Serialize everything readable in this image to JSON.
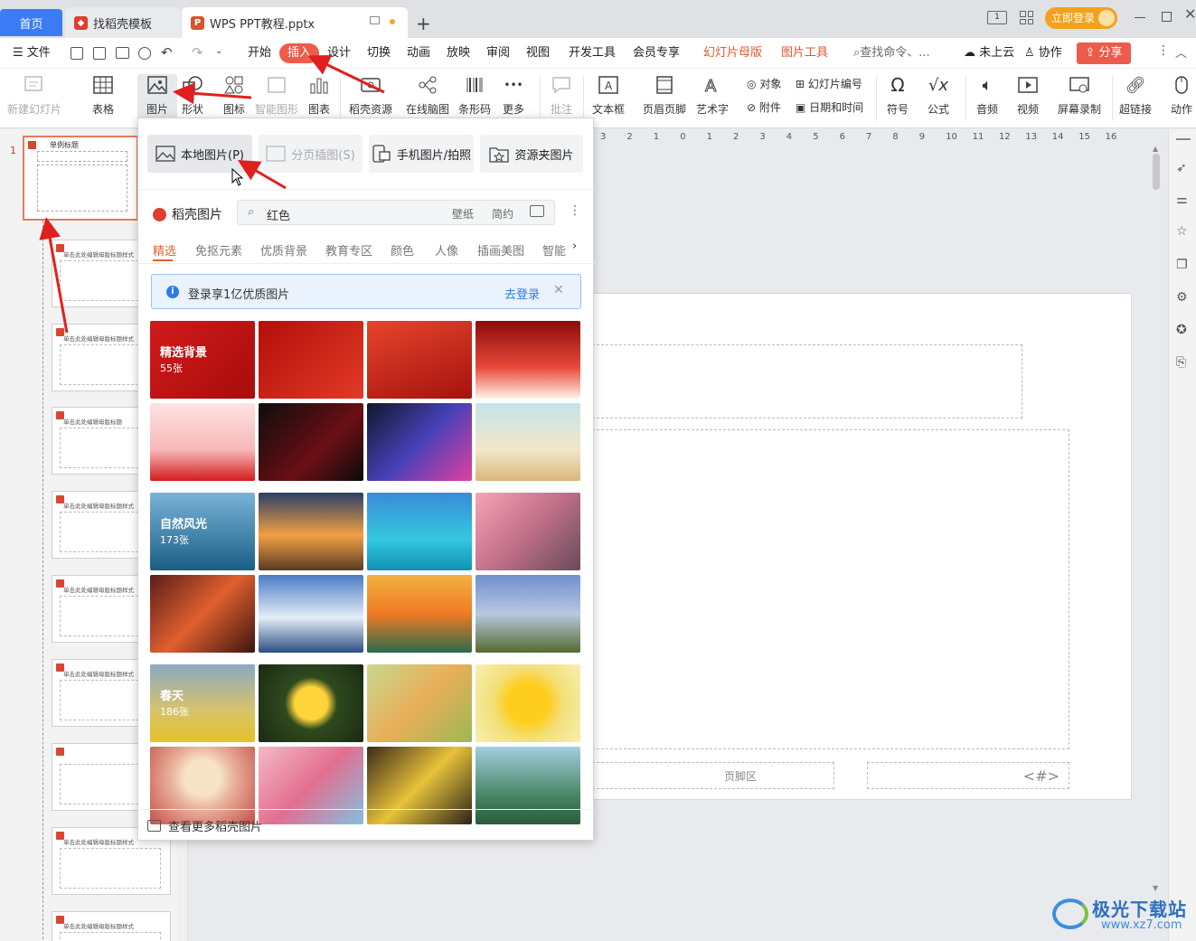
{
  "tabs": {
    "home": "首页",
    "template": "找稻壳模板",
    "document": "WPS PPT教程.pptx",
    "login": "立即登录"
  },
  "menu": {
    "file": "文件",
    "items": [
      "开始",
      "插入",
      "设计",
      "切换",
      "动画",
      "放映",
      "审阅",
      "视图",
      "开发工具",
      "会员专享"
    ],
    "context": [
      "幻灯片母版",
      "图片工具"
    ],
    "search": "查找命令、...",
    "cloud": "未上云",
    "collab": "协作",
    "share": "分享"
  },
  "ribbon": {
    "new_slide": "新建幻灯片",
    "table": "表格",
    "picture": "图片",
    "shape": "形状",
    "icon": "图标",
    "smart": "智能图形",
    "chart": "图表",
    "resource": "稻壳资源",
    "mindmap": "在线脑图",
    "barcode": "条形码",
    "more": "更多",
    "comment": "批注",
    "textbox": "文本框",
    "header_footer": "页眉页脚",
    "wordart": "艺术字",
    "object": "对象",
    "slide_number": "幻灯片编号",
    "attachment": "附件",
    "date_time": "日期和时间",
    "symbol": "符号",
    "formula": "公式",
    "audio": "音频",
    "video": "视频",
    "screen_record": "屏幕录制",
    "hyperlink": "超链接",
    "action": "动作"
  },
  "popup": {
    "local_picture": "本地图片(P)",
    "page_insert": "分页插图(S)",
    "phone_picture": "手机图片/拍照",
    "folder_picture": "资源夹图片",
    "brand": "稻壳图片",
    "search_value": "红色",
    "search_tags": [
      "壁纸",
      "简约"
    ],
    "categories": [
      "精选",
      "免抠元素",
      "优质背景",
      "教育专区",
      "颜色",
      "人像",
      "插画美图",
      "智能"
    ],
    "notice": "登录享1亿优质图片",
    "notice_link": "去登录",
    "groups": [
      {
        "name": "精选背景",
        "count": "55张"
      },
      {
        "name": "自然风光",
        "count": "173张"
      },
      {
        "name": "春天",
        "count": "186张"
      }
    ],
    "more_link": "查看更多稻壳图片"
  },
  "slide_panel": {
    "first_slide_num": "1",
    "first_title": "单例标题",
    "thumbs": [
      "单击此处编辑母版标题样式",
      "单击此处编辑母版标题样式",
      "单击此处编辑母版标题",
      "单击此处编辑母版标题样式",
      "单击此处编辑母版标题样式",
      "单击此处编辑母版标题样式",
      "",
      "单击此处编辑母版标题样式",
      "单击此处编辑母版标题样式"
    ]
  },
  "ruler": [
    "3",
    "2",
    "1",
    "0",
    "1",
    "2",
    "3",
    "4",
    "5",
    "6",
    "7",
    "8",
    "9",
    "10",
    "11",
    "12",
    "13",
    "14",
    "15",
    "16"
  ],
  "slide": {
    "footer": "页脚区",
    "page_num": "<#>"
  },
  "watermark": {
    "name": "极光下载站",
    "url": "www.xz7.com"
  }
}
